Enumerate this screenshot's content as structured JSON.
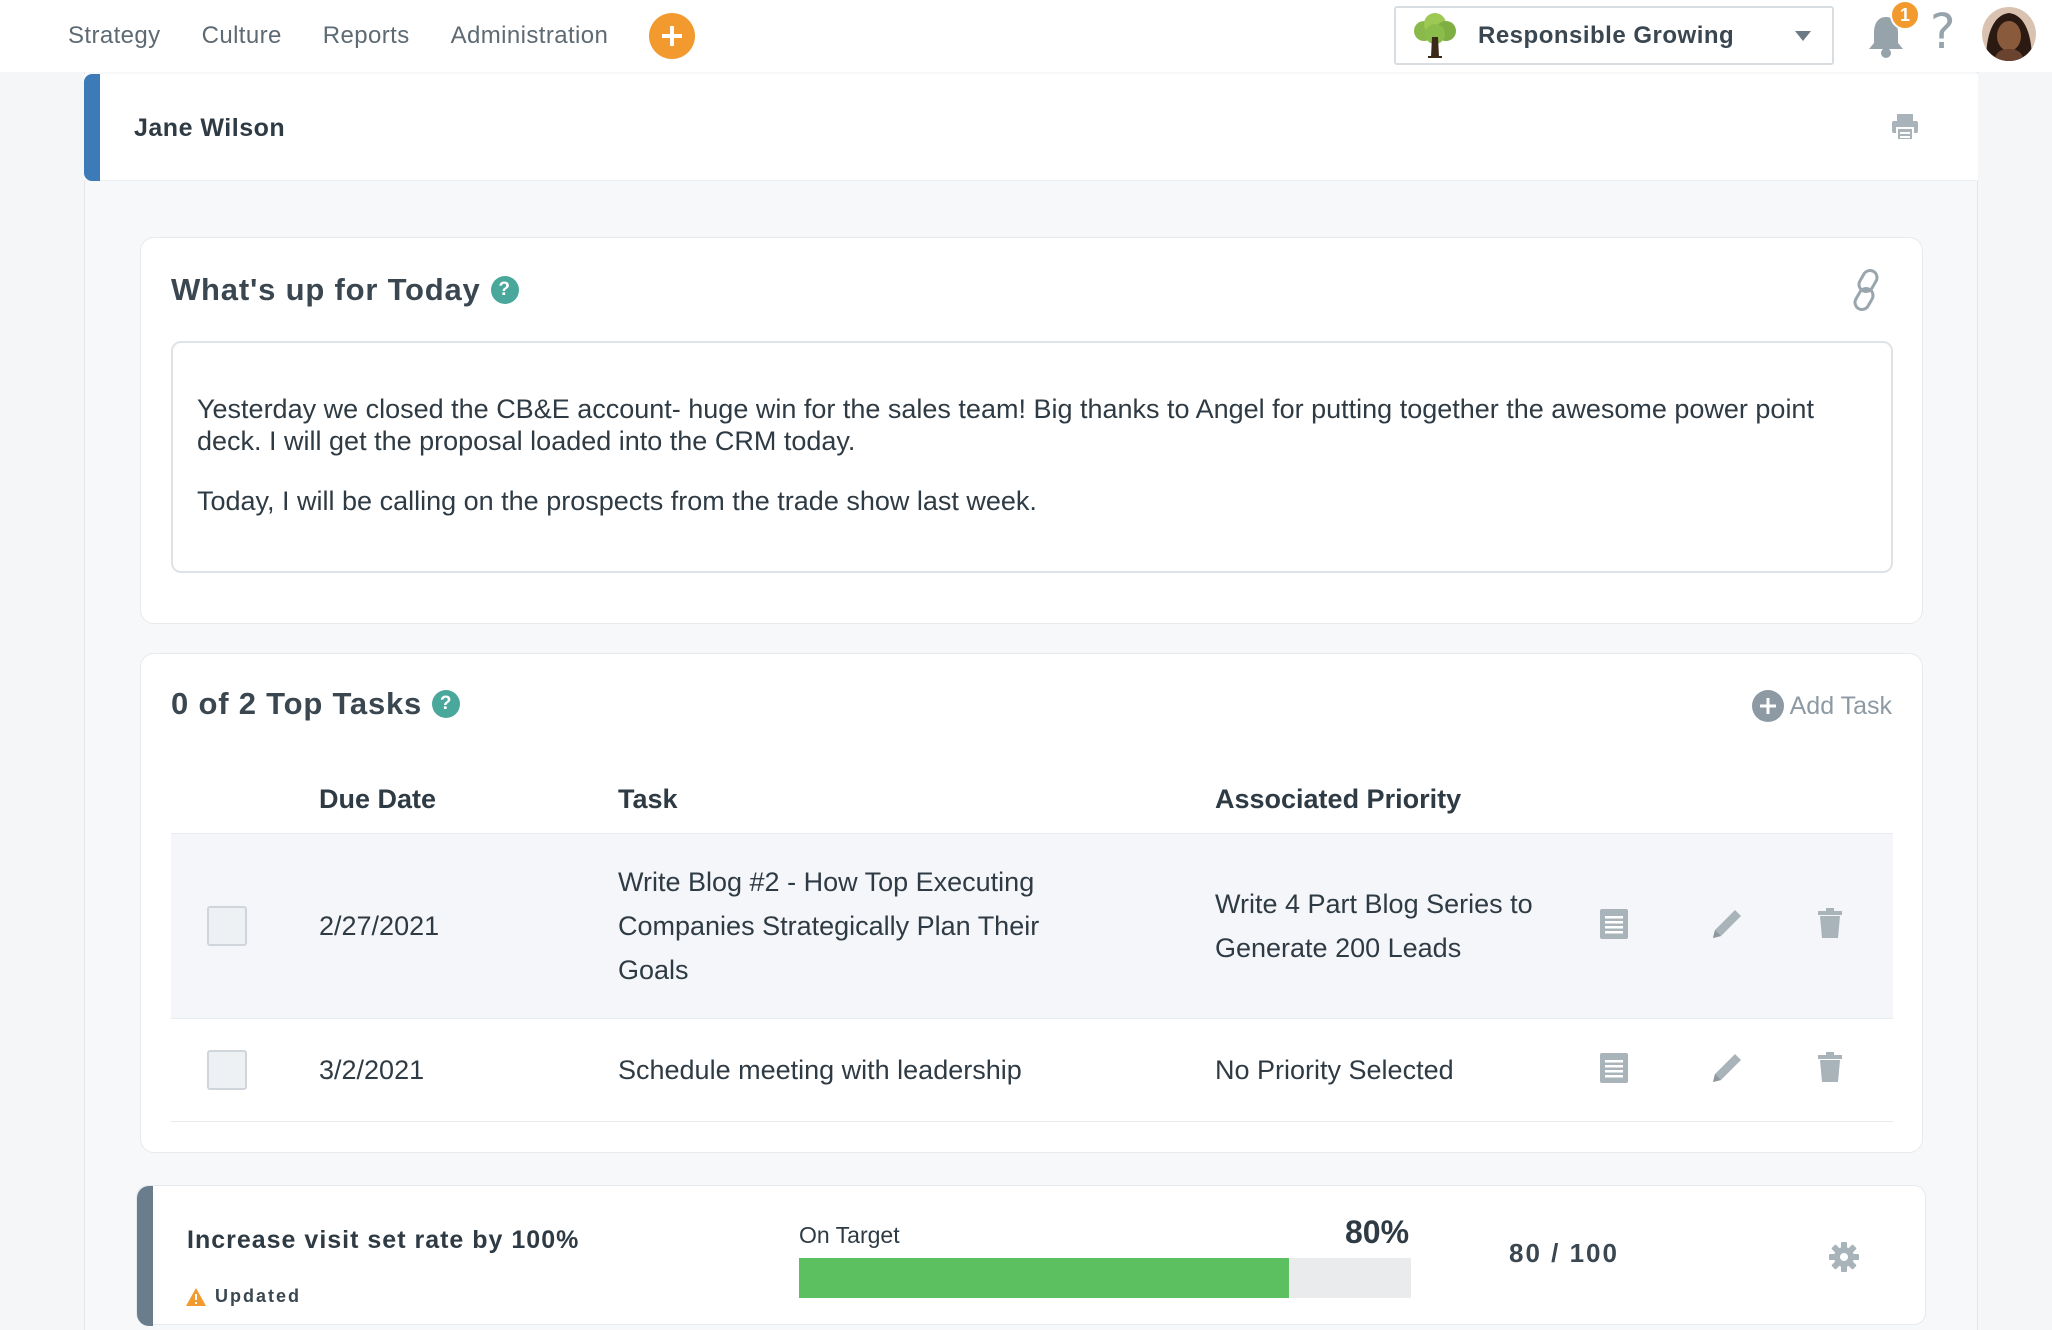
{
  "nav": {
    "items": [
      "Strategy",
      "Culture",
      "Reports",
      "Administration"
    ],
    "add_icon": "plus-circle-icon"
  },
  "org_selector": {
    "name": "Responsible Growing",
    "logo_icon": "tree-icon",
    "caret_icon": "caret-down-icon"
  },
  "header_right": {
    "notification_count": "1",
    "help_label": "?",
    "bell_icon": "bell-icon",
    "avatar_icon": "user-avatar"
  },
  "user": {
    "name": "Jane Wilson",
    "print_icon": "print-icon"
  },
  "today": {
    "title": "What's up for Today",
    "help": "?",
    "link_icon": "link-icon",
    "paragraphs": [
      "Yesterday we closed the CB&E account- huge win for the sales team! Big thanks to Angel for putting together the awesome power point deck. I will get the proposal loaded into the CRM today.",
      "Today, I will be calling on the prospects from the trade show last week."
    ]
  },
  "tasks": {
    "title": "0 of 2 Top Tasks",
    "help": "?",
    "add_label": "Add Task",
    "columns": {
      "due": "Due Date",
      "task": "Task",
      "priority": "Associated Priority"
    },
    "rows": [
      {
        "due": "2/27/2021",
        "task": "Write Blog #2 - How Top Executing Companies Strategically Plan Their Goals",
        "priority": "Write 4 Part Blog Series to Generate 200 Leads",
        "checked": false
      },
      {
        "due": "3/2/2021",
        "task": "Schedule meeting with leadership",
        "priority": "No Priority Selected",
        "checked": false
      }
    ],
    "action_icons": [
      "notes-icon",
      "pencil-icon",
      "trash-icon"
    ]
  },
  "metric": {
    "title": "Increase visit set rate by 100%",
    "updated_label": "Updated",
    "warning_icon": "warning-icon",
    "status": "On Target",
    "percent_label": "80%",
    "percent": 0.8,
    "score": "80 / 100",
    "gear_icon": "gear-icon"
  },
  "colors": {
    "accent_orange": "#f29a2e",
    "header_blue": "#3d7bb8",
    "help_teal": "#4aa79b",
    "progress_green": "#5cbf60"
  }
}
